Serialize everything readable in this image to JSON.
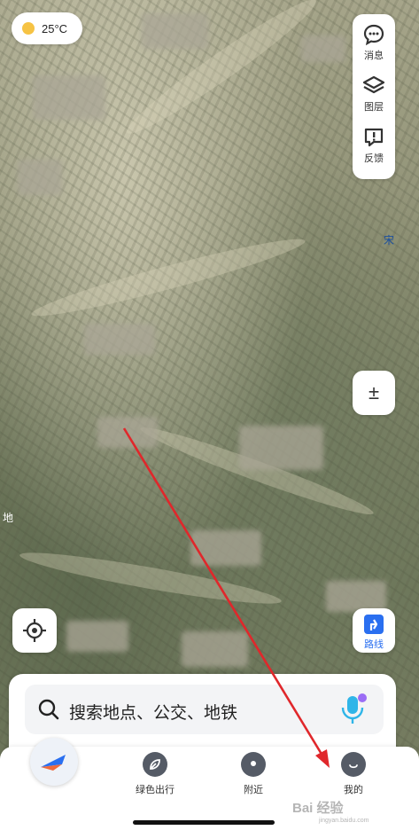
{
  "weather": {
    "temperature": "25°C",
    "icon": "sun-icon"
  },
  "side_panel": {
    "items": [
      {
        "label": "消息",
        "icon": "message-icon"
      },
      {
        "label": "图层",
        "icon": "layers-icon"
      },
      {
        "label": "反馈",
        "icon": "feedback-icon"
      }
    ]
  },
  "map": {
    "edge_label_right": "宋",
    "edge_label_left": "地"
  },
  "zoom": {
    "label": "±"
  },
  "route": {
    "label": "路线"
  },
  "search": {
    "placeholder": "搜索地点、公交、地铁"
  },
  "bottom_nav": {
    "items": [
      {
        "label": "绿色出行",
        "icon": "leaf-icon"
      },
      {
        "label": "附近",
        "icon": "location-pin-icon"
      },
      {
        "label": "我的",
        "icon": "profile-icon"
      }
    ]
  },
  "watermark": {
    "text": "Bai 经验",
    "sub": "jingyan.baidu.com"
  },
  "colors": {
    "accent": "#2a6ff0",
    "arrow": "#e0272b",
    "nav_icon": "#555b66"
  }
}
